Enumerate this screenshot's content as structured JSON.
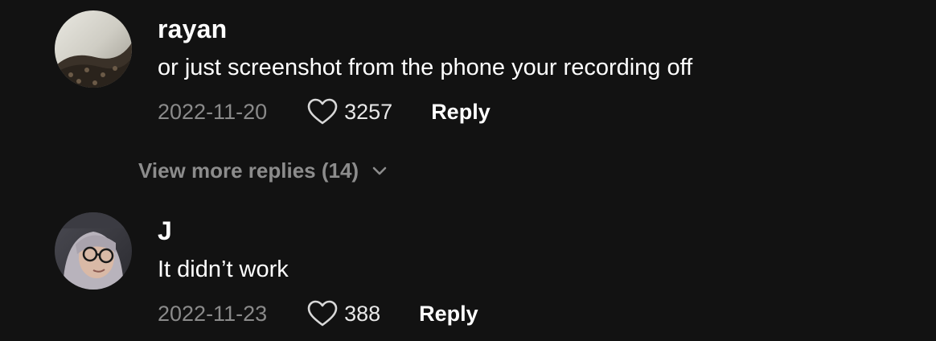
{
  "comments": [
    {
      "username": "rayan",
      "text": "or just screenshot from the phone your recording off",
      "date": "2022-11-20",
      "likes": "3257",
      "reply_label": "Reply"
    },
    {
      "username": "J",
      "text": "It didn’t work",
      "date": "2022-11-23",
      "likes": "388",
      "reply_label": "Reply"
    }
  ],
  "view_more": {
    "label": "View more replies (14)"
  },
  "colors": {
    "background": "#121212",
    "muted_text": "#8a8a8a",
    "primary_text": "#ffffff"
  },
  "icons": [
    "heart-icon",
    "chevron-down-icon"
  ]
}
